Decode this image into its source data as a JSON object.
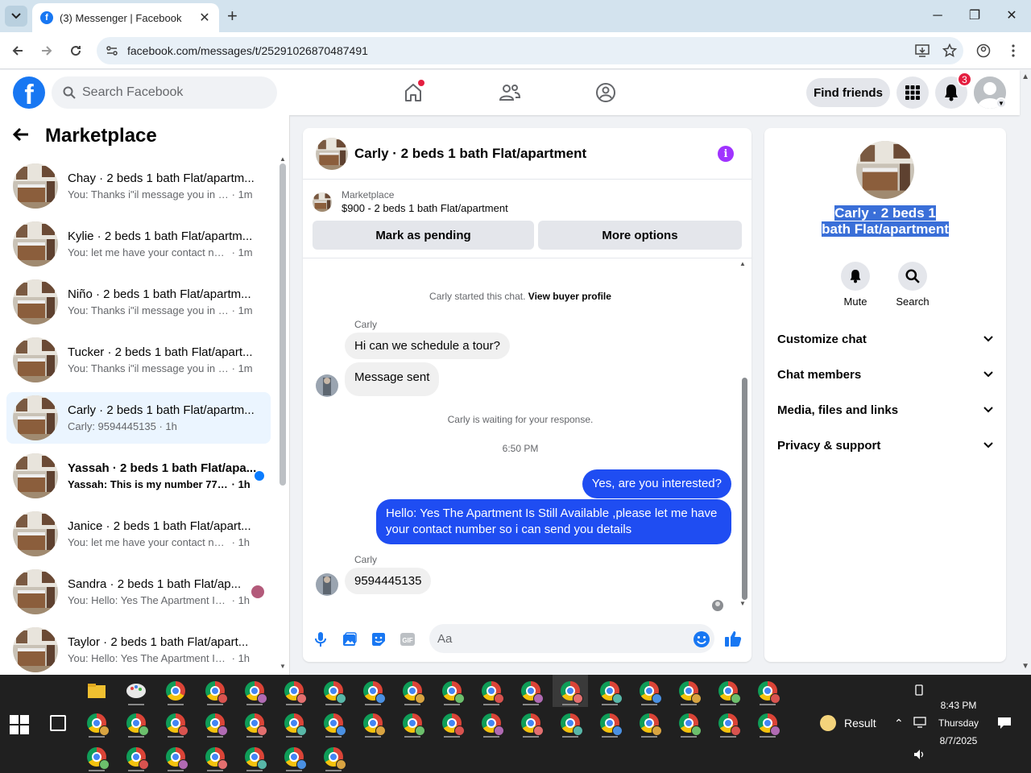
{
  "browser": {
    "tab_title": "(3) Messenger | Facebook",
    "url": "facebook.com/messages/t/25291026870487491",
    "window_controls": {
      "minimize": "─",
      "restore": "❐",
      "close": "✕"
    }
  },
  "fb_header": {
    "search_placeholder": "Search Facebook",
    "find_friends": "Find friends",
    "notification_count": "3",
    "logo_letter": "f"
  },
  "left_pane": {
    "title": "Marketplace",
    "conversations": [
      {
        "name": "Chay · 2 beds 1 bath Flat/apartm...",
        "preview": "You: Thanks i\"il message you in a ...",
        "time": "· 1m",
        "selected": false,
        "unread": false
      },
      {
        "name": "Kylie · 2 beds 1 bath Flat/apartm...",
        "preview": "You: let me have your contact num...",
        "time": "· 1m",
        "selected": false,
        "unread": false
      },
      {
        "name": "Niño · 2 beds 1 bath Flat/apartm...",
        "preview": "You: Thanks i\"il message you in a ...",
        "time": "· 1m",
        "selected": false,
        "unread": false
      },
      {
        "name": "Tucker · 2 beds 1 bath Flat/apart...",
        "preview": "You: Thanks i\"il message you in a ...",
        "time": "· 1m",
        "selected": false,
        "unread": false
      },
      {
        "name": "Carly · 2 beds 1 bath Flat/apartm...",
        "preview": "Carly: 9594445135",
        "time": "· 1h",
        "selected": true,
        "unread": false
      },
      {
        "name": "Yassah · 2 beds 1 bath Flat/apa...",
        "preview": "Yassah: This is my number 7742...",
        "time": "· 1h",
        "selected": false,
        "unread": true
      },
      {
        "name": "Janice · 2 beds 1 bath Flat/apart...",
        "preview": "You: let me have your contact num...",
        "time": "· 1h",
        "selected": false,
        "unread": false
      },
      {
        "name": "Sandra · 2 beds 1 bath Flat/ap...",
        "preview": "You: Hello: Yes The Apartment Is ...",
        "time": "· 1h",
        "selected": false,
        "unread": false
      },
      {
        "name": "Taylor · 2 beds 1 bath Flat/apart...",
        "preview": "You: Hello: Yes The Apartment Is Sti...",
        "time": "· 1h",
        "selected": false,
        "unread": false
      }
    ]
  },
  "chat": {
    "title": "Carly · 2 beds 1 bath Flat/apartment",
    "marketplace_label": "Marketplace",
    "listing": "$900 - 2 beds 1 bath Flat/apartment",
    "mark_pending": "Mark as pending",
    "more_options": "More options",
    "started_text": "Carly started this chat.",
    "view_buyer": "View buyer profile",
    "sender_name": "Carly",
    "msg1": "Hi can we schedule a tour?",
    "msg2": "Message sent",
    "waiting_text": "Carly is waiting for your response.",
    "time_divider": "6:50 PM",
    "out1": "Yes, are you interested?",
    "out2": "Hello: Yes The Apartment Is Still Available ,please let me have your contact number so i can send you details",
    "sender_name2": "Carly",
    "msg3": "9594445135",
    "composer_placeholder": "Aa"
  },
  "info_pane": {
    "title": "Carly · 2 beds 1 bath Flat/apartment",
    "mute": "Mute",
    "search": "Search",
    "rows": [
      "Customize chat",
      "Chat members",
      "Media, files and links",
      "Privacy & support"
    ]
  },
  "taskbar": {
    "result_label": "Result",
    "time": "8:43 PM",
    "day": "Thursday",
    "date": "8/7/2025"
  },
  "colors": {
    "accent": "#1877f2",
    "outgoing_bubble": "#1f4df2",
    "selected_row": "#ebf5ff",
    "info_button": "#a033ff"
  }
}
